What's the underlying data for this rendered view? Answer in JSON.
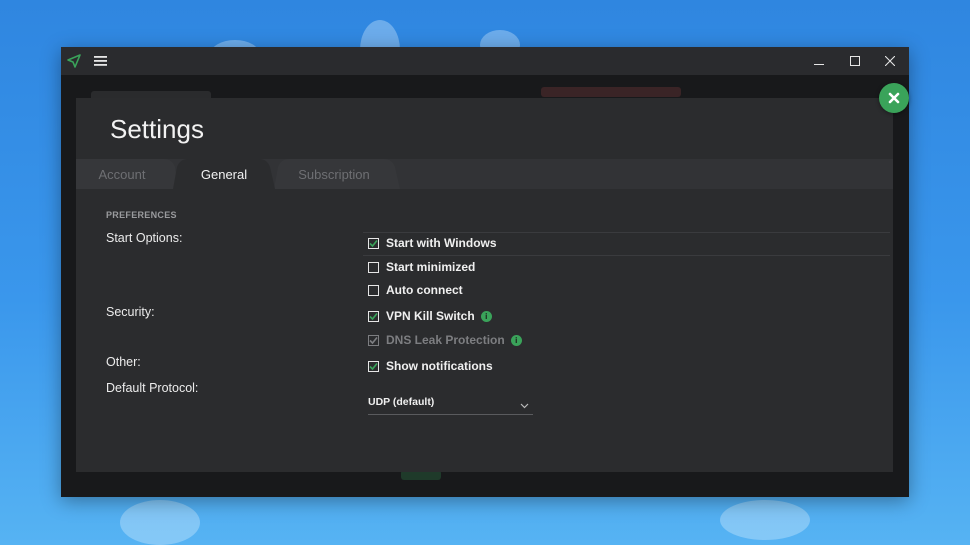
{
  "titlebar": {
    "app_icon": "send-icon",
    "menu_icon": "hamburger-icon",
    "minimize_icon": "minimize-icon",
    "maximize_icon": "maximize-icon",
    "close_icon": "close-icon"
  },
  "settings": {
    "title": "Settings",
    "close_icon": "close-circle-icon",
    "tabs": [
      {
        "label": "Account",
        "active": false
      },
      {
        "label": "General",
        "active": true
      },
      {
        "label": "Subscription",
        "active": false
      }
    ],
    "section_heading": "PREFERENCES",
    "labels": {
      "start_options": "Start Options:",
      "security": "Security:",
      "other": "Other:",
      "default_protocol": "Default Protocol:"
    },
    "options": {
      "start_with_windows": {
        "label": "Start with Windows",
        "checked": true
      },
      "start_minimized": {
        "label": "Start minimized",
        "checked": false
      },
      "auto_connect": {
        "label": "Auto connect",
        "checked": false
      },
      "vpn_kill_switch": {
        "label": "VPN Kill Switch",
        "checked": true,
        "info_icon": "info-icon"
      },
      "dns_leak_protection": {
        "label": "DNS Leak Protection",
        "checked": true,
        "disabled": true,
        "info_icon": "info-icon"
      },
      "show_notifications": {
        "label": "Show notifications",
        "checked": true
      }
    },
    "protocol": {
      "value": "UDP (default)",
      "chevron_icon": "chevron-down-icon"
    }
  },
  "colors": {
    "accent": "#3aa35a",
    "panel_bg": "#2b2c2e",
    "window_bg": "#1e1f22",
    "desktop_blue": "#3a97ec"
  }
}
